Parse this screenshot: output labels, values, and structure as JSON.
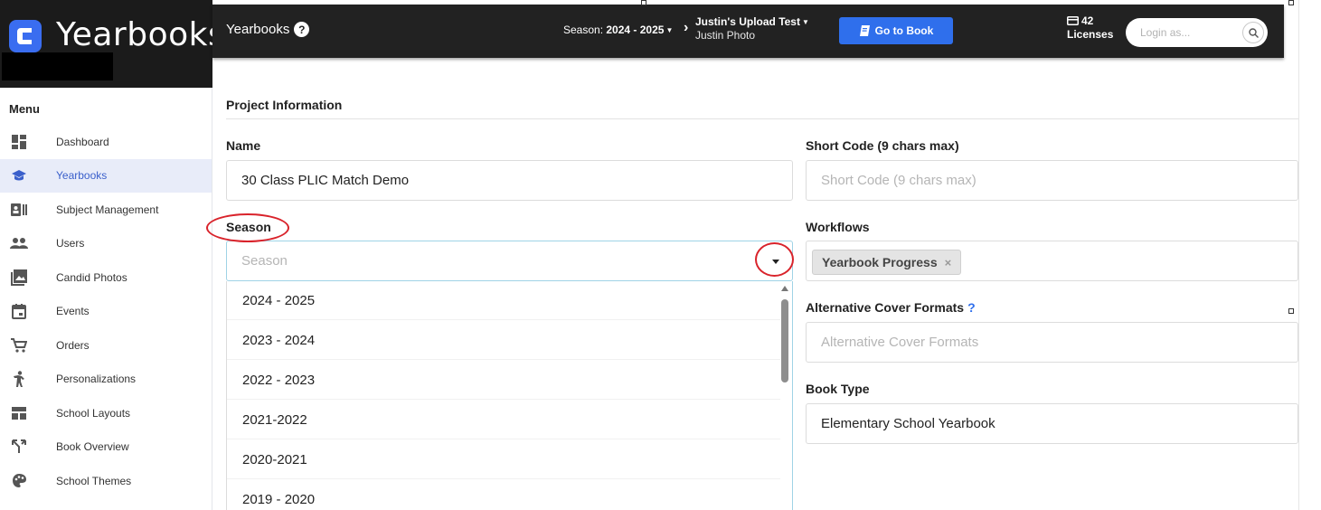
{
  "brand": {
    "title": "Yearbooks"
  },
  "sidebar": {
    "menu_title": "Menu",
    "items": [
      {
        "label": "Dashboard",
        "icon": "dashboard-icon"
      },
      {
        "label": "Yearbooks",
        "icon": "graduation-cap-icon",
        "active": true
      },
      {
        "label": "Subject Management",
        "icon": "id-card-icon"
      },
      {
        "label": "Users",
        "icon": "users-icon"
      },
      {
        "label": "Candid Photos",
        "icon": "photo-icon"
      },
      {
        "label": "Events",
        "icon": "calendar-icon"
      },
      {
        "label": "Orders",
        "icon": "cart-icon"
      },
      {
        "label": "Personalizations",
        "icon": "person-icon"
      },
      {
        "label": "School Layouts",
        "icon": "layout-icon"
      },
      {
        "label": "Book Overview",
        "icon": "split-icon"
      },
      {
        "label": "School Themes",
        "icon": "palette-icon"
      }
    ]
  },
  "topbar": {
    "title": "Yearbooks",
    "help": "?",
    "season_prefix": "Season: ",
    "season_value": "2024 - 2025",
    "project_name": "Justin's Upload Test",
    "project_sub": "Justin Photo",
    "goto_label": "Go to Book",
    "licenses_count": "42",
    "licenses_label": "Licenses",
    "login_placeholder": "Login as..."
  },
  "form": {
    "section_title": "Project Information",
    "name_label": "Name",
    "name_value": "30 Class PLIC Match Demo",
    "shortcode_label": "Short Code (9 chars max)",
    "shortcode_placeholder": "Short Code (9 chars max)",
    "season_label": "Season",
    "season_placeholder": "Season",
    "season_options": [
      "2024 - 2025",
      "2023 - 2024",
      "2022 - 2023",
      "2021-2022",
      "2020-2021",
      "2019 - 2020"
    ],
    "workflows_label": "Workflows",
    "workflow_tag": "Yearbook Progress",
    "workflow_tag_remove": "×",
    "altcover_label": "Alternative Cover Formats",
    "altcover_help": "?",
    "altcover_placeholder": "Alternative Cover Formats",
    "booktype_label": "Book Type",
    "booktype_value": "Elementary School Yearbook"
  },
  "colors": {
    "accent": "#2f6fec",
    "topbar": "#222222",
    "active_bg": "#e8ecf9",
    "annotation": "#d9232b"
  }
}
